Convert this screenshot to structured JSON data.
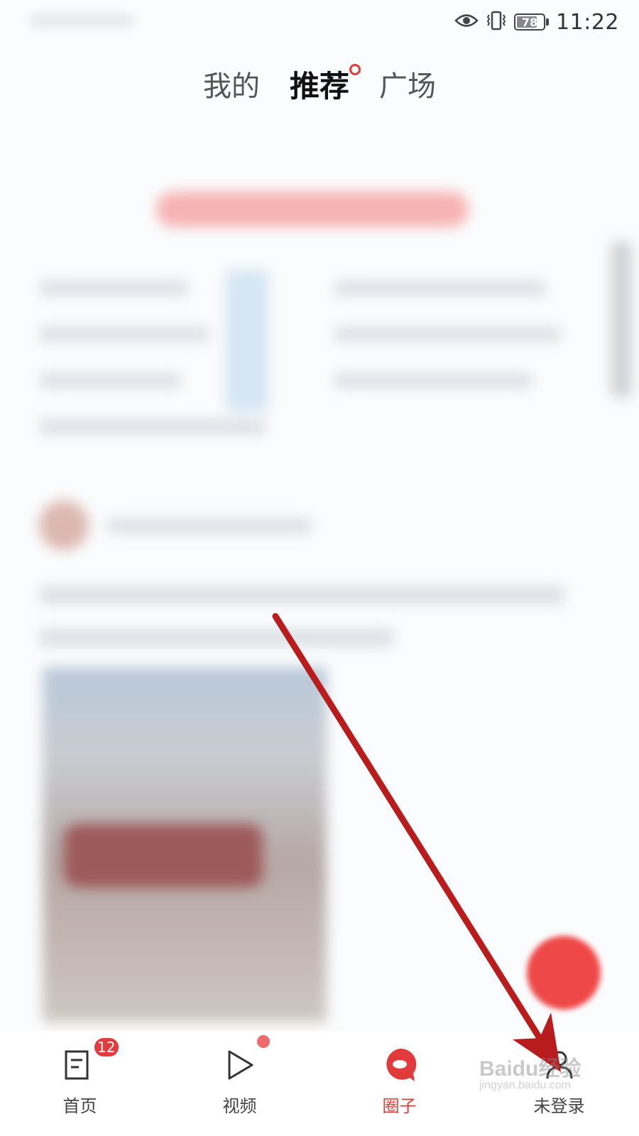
{
  "status_bar": {
    "battery_level": "78",
    "battery_fraction": 0.78,
    "time": "11:22",
    "icons": [
      "eye-icon",
      "vibrate-icon",
      "battery-icon"
    ]
  },
  "top_tabs": [
    {
      "label": "我的",
      "active": false
    },
    {
      "label": "推荐",
      "active": true,
      "dot": true
    },
    {
      "label": "广场",
      "active": false
    }
  ],
  "bottom_nav": {
    "items": [
      {
        "label": "首页",
        "icon": "news-icon",
        "badge": "12"
      },
      {
        "label": "视频",
        "icon": "play-icon",
        "dot": true
      },
      {
        "label": "圈子",
        "icon": "circle-bubble-icon",
        "active": true
      },
      {
        "label": "未登录",
        "icon": "user-icon"
      }
    ]
  },
  "colors": {
    "accent": "#e23b3b",
    "annotation_arrow": "#b81c1c",
    "fab": "#ef4848"
  },
  "watermark": {
    "brand": "Baidu经验",
    "domain": "jingyan.baidu.com"
  }
}
